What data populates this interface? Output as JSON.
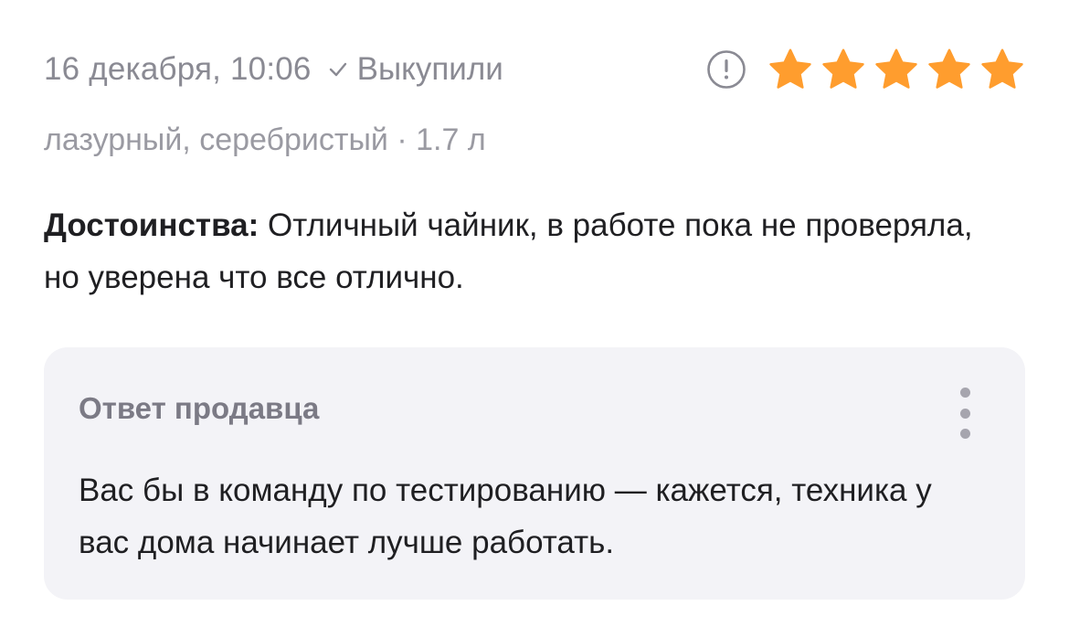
{
  "review": {
    "date": "16 декабря, 10:06",
    "status": "Выкупили",
    "rating": 5,
    "rating_max": 5,
    "variant": "лазурный, серебристый · 1.7 л",
    "advantages_label": "Достоинства:",
    "advantages_text": "Отличный чайник, в работе пока не проверяла, но уверена что все отлично."
  },
  "seller_answer": {
    "title": "Ответ продавца",
    "text": "Вас бы в команду по тестированию — кажется, техника у вас дома начинает лучше работать."
  },
  "icons": {
    "status": "check-icon",
    "report": "exclamation-circle-icon",
    "rating": "star-icon",
    "menu": "more-vertical-icon"
  },
  "colors": {
    "star": "#ff9d2e",
    "panel_bg": "#f3f3f7",
    "muted_text": "#8a8a93",
    "main_text": "#1f1f22"
  }
}
